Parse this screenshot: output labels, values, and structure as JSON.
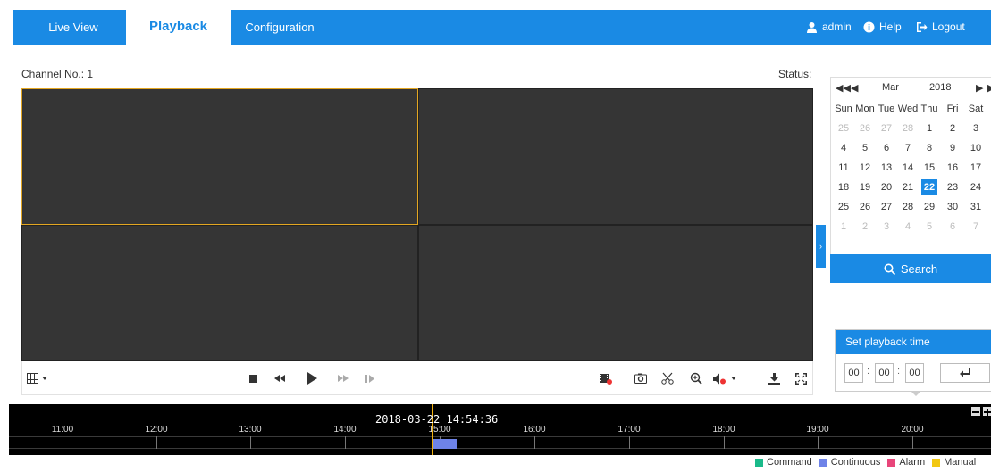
{
  "nav": {
    "tabs": [
      {
        "label": "Live View",
        "active": false
      },
      {
        "label": "Playback",
        "active": true
      },
      {
        "label": "Configuration",
        "active": false
      }
    ],
    "user": "admin",
    "help": "Help",
    "logout": "Logout"
  },
  "player": {
    "channel_label": "Channel No.: 1",
    "status_label": "Status:",
    "layout": "2x2",
    "selected_window": 1
  },
  "calendar": {
    "month": "Mar",
    "year": "2018",
    "weekdays": [
      "Sun",
      "Mon",
      "Tue",
      "Wed",
      "Thu",
      "Fri",
      "Sat"
    ],
    "weeks": [
      [
        "25",
        "26",
        "27",
        "28",
        "1",
        "2",
        "3"
      ],
      [
        "4",
        "5",
        "6",
        "7",
        "8",
        "9",
        "10"
      ],
      [
        "11",
        "12",
        "13",
        "14",
        "15",
        "16",
        "17"
      ],
      [
        "18",
        "19",
        "20",
        "21",
        "22",
        "23",
        "24"
      ],
      [
        "25",
        "26",
        "27",
        "28",
        "29",
        "30",
        "31"
      ],
      [
        "1",
        "2",
        "3",
        "4",
        "5",
        "6",
        "7"
      ]
    ],
    "selected_day": "22"
  },
  "search": {
    "label": "Search"
  },
  "playback_time": {
    "title": "Set playback time",
    "hh": "00",
    "mm": "00",
    "ss": "00"
  },
  "timeline": {
    "current_time": "2018-03-22 14:54:36",
    "hours": [
      "11:00",
      "12:00",
      "13:00",
      "14:00",
      "15:00",
      "16:00",
      "17:00",
      "18:00",
      "19:00",
      "20:00"
    ]
  },
  "legend": [
    {
      "label": "Command",
      "color": "#1aba8a"
    },
    {
      "label": "Continuous",
      "color": "#6e83e8"
    },
    {
      "label": "Alarm",
      "color": "#e8457a"
    },
    {
      "label": "Manual",
      "color": "#f2c812"
    }
  ],
  "colors": {
    "accent": "#1a8ae4",
    "selection": "#e3a621"
  }
}
